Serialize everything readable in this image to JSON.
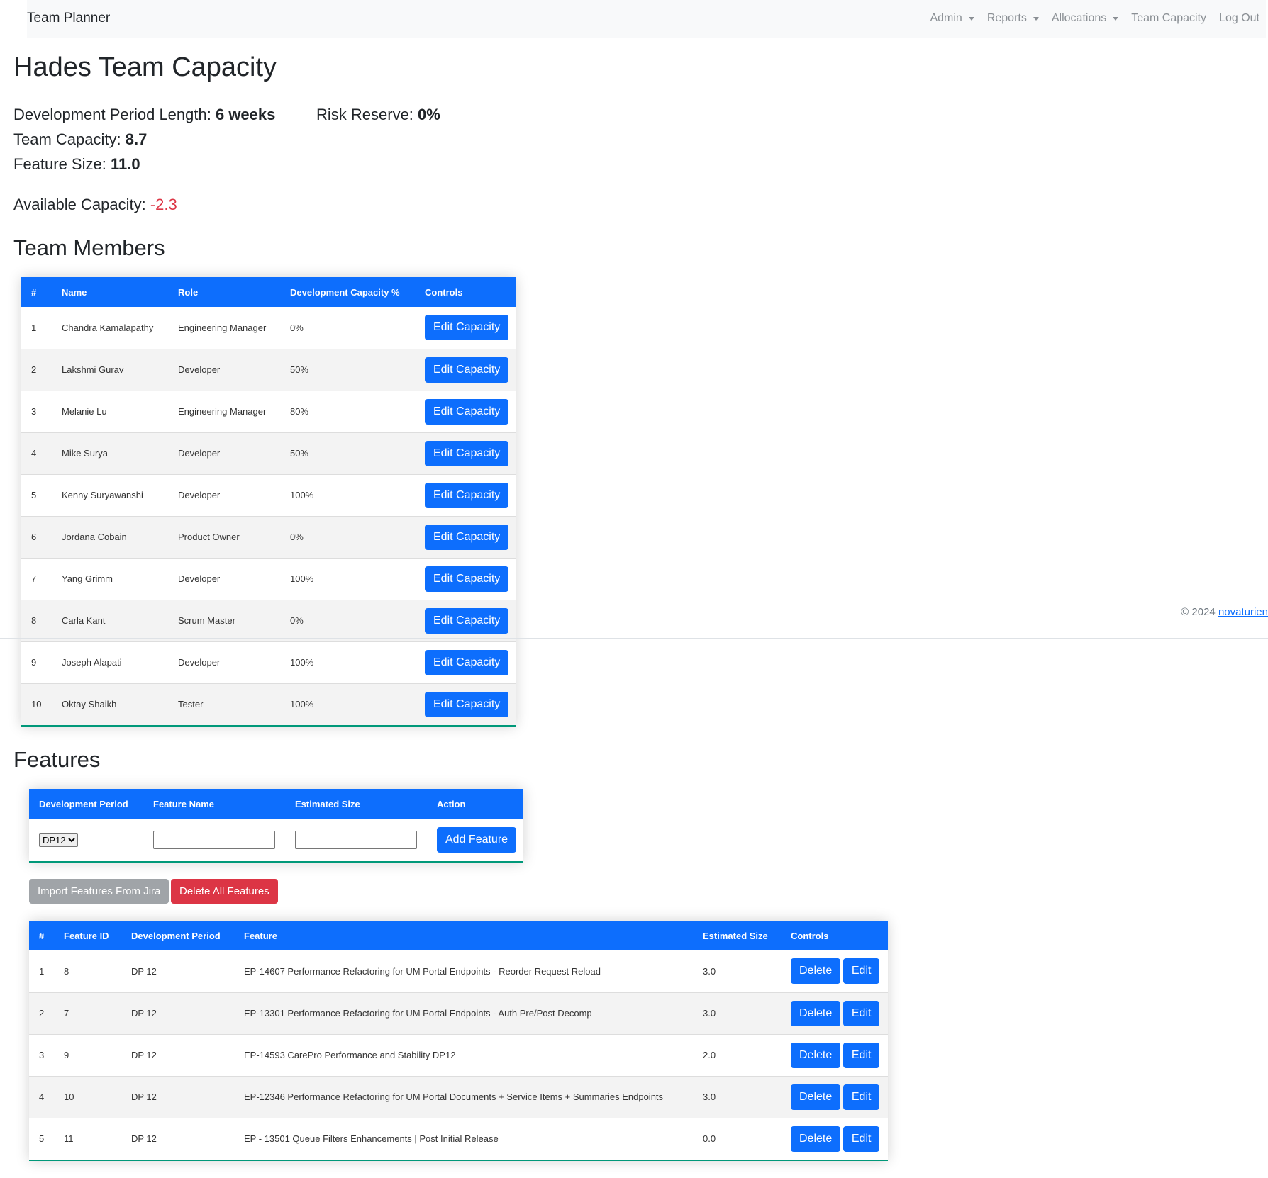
{
  "navbar": {
    "brand": "Team Planner",
    "items": [
      {
        "label": "Admin",
        "dropdown": true
      },
      {
        "label": "Reports",
        "dropdown": true
      },
      {
        "label": "Allocations",
        "dropdown": true
      },
      {
        "label": "Team Capacity",
        "dropdown": false
      },
      {
        "label": "Log Out",
        "dropdown": false
      }
    ]
  },
  "page": {
    "title": "Hades Team Capacity",
    "dev_period_label": "Development Period Length: ",
    "dev_period_value": "6 weeks",
    "risk_label": "Risk Reserve: ",
    "risk_value": "0%",
    "capacity_label": "Team Capacity: ",
    "capacity_value": "8.7",
    "feature_size_label": "Feature Size: ",
    "feature_size_value": "11.0",
    "available_label": "Available Capacity: ",
    "available_value": "-2.3"
  },
  "team": {
    "title": "Team Members",
    "headers": [
      "#",
      "Name",
      "Role",
      "Development Capacity %",
      "Controls"
    ],
    "button_label": "Edit Capacity",
    "rows": [
      {
        "n": "1",
        "name": "Chandra Kamalapathy",
        "role": "Engineering Manager",
        "capacity": "0%"
      },
      {
        "n": "2",
        "name": "Lakshmi Gurav",
        "role": "Developer",
        "capacity": "50%"
      },
      {
        "n": "3",
        "name": "Melanie Lu",
        "role": "Engineering Manager",
        "capacity": "80%"
      },
      {
        "n": "4",
        "name": "Mike Surya",
        "role": "Developer",
        "capacity": "50%"
      },
      {
        "n": "5",
        "name": "Kenny Suryawanshi",
        "role": "Developer",
        "capacity": "100%"
      },
      {
        "n": "6",
        "name": "Jordana Cobain",
        "role": "Product Owner",
        "capacity": "0%"
      },
      {
        "n": "7",
        "name": "Yang Grimm",
        "role": "Developer",
        "capacity": "100%"
      },
      {
        "n": "8",
        "name": "Carla Kant",
        "role": "Scrum Master",
        "capacity": "0%"
      },
      {
        "n": "9",
        "name": "Joseph Alapati",
        "role": "Developer",
        "capacity": "100%"
      },
      {
        "n": "10",
        "name": "Oktay Shaikh",
        "role": "Tester",
        "capacity": "100%"
      }
    ]
  },
  "features": {
    "title": "Features",
    "form_headers": [
      "Development Period",
      "Feature Name",
      "Estimated Size",
      "Action"
    ],
    "period_selected": "DP12",
    "add_label": "Add Feature",
    "import_label": "Import Features From Jira",
    "delete_all_label": "Delete All Features",
    "headers": [
      "#",
      "Feature ID",
      "Development Period",
      "Feature",
      "Estimated Size",
      "Controls"
    ],
    "delete_label": "Delete",
    "edit_label": "Edit",
    "rows": [
      {
        "n": "1",
        "id": "8",
        "period": "DP 12",
        "feature": "EP-14607 Performance Refactoring for UM Portal Endpoints - Reorder Request Reload",
        "size": "3.0"
      },
      {
        "n": "2",
        "id": "7",
        "period": "DP 12",
        "feature": "EP-13301 Performance Refactoring for UM Portal Endpoints - Auth Pre/Post Decomp",
        "size": "3.0"
      },
      {
        "n": "3",
        "id": "9",
        "period": "DP 12",
        "feature": "EP-14593 CarePro Performance and Stability DP12",
        "size": "2.0"
      },
      {
        "n": "4",
        "id": "10",
        "period": "DP 12",
        "feature": "EP-12346 Performance Refactoring for UM Portal Documents + Service Items + Summaries Endpoints",
        "size": "3.0"
      },
      {
        "n": "5",
        "id": "11",
        "period": "DP 12",
        "feature": "EP - 13501 Queue Filters Enhancements | Post Initial Release",
        "size": "0.0"
      }
    ]
  },
  "footer": {
    "copyright": "© 2024 ",
    "link": "novaturien"
  }
}
